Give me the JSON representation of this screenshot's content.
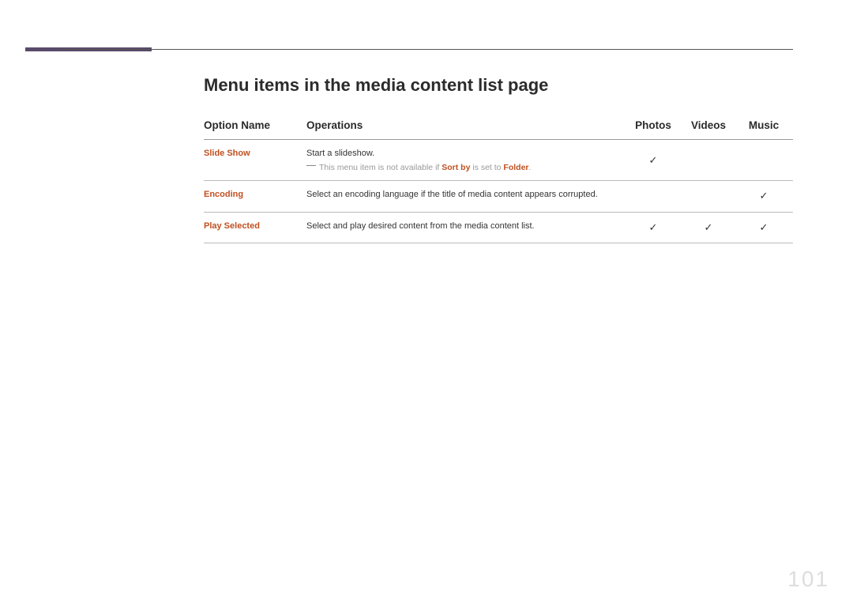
{
  "section_title": "Menu items in the media content list page",
  "headers": {
    "option_name": "Option Name",
    "operations": "Operations",
    "photos": "Photos",
    "videos": "Videos",
    "music": "Music"
  },
  "rows": [
    {
      "name": "Slide Show",
      "operation_main": "Start a slideshow.",
      "note_prefix": "This menu item is not available if ",
      "note_bold1": "Sort by",
      "note_mid": " is set to ",
      "note_bold2": "Folder",
      "note_suffix": ".",
      "photos": "✓",
      "videos": "",
      "music": ""
    },
    {
      "name": "Encoding",
      "operation_main": "Select an encoding language if the title of media content appears corrupted.",
      "photos": "",
      "videos": "",
      "music": "✓"
    },
    {
      "name": "Play Selected",
      "operation_main": "Select and play desired content from the media content list.",
      "photos": "✓",
      "videos": "✓",
      "music": "✓"
    }
  ],
  "page_number": "101"
}
